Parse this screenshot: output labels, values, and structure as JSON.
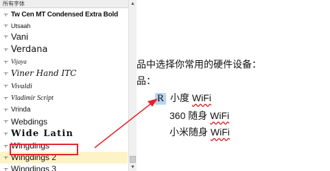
{
  "font_panel": {
    "header": "所有字体",
    "tt_glyph": "ㅜ",
    "items": [
      {
        "label": "Tw Cen MT Condensed Extra Bold"
      },
      {
        "label": "Utsaah"
      },
      {
        "label": "Vani"
      },
      {
        "label": "Verdana"
      },
      {
        "label": "Vijaya"
      },
      {
        "label": "Viner Hand ITC"
      },
      {
        "label": "Vivaldi"
      },
      {
        "label": "Vladimir Script"
      },
      {
        "label": "Vrinda"
      },
      {
        "label": "Webdings"
      },
      {
        "label": "Wide Latin"
      },
      {
        "label": "Wingdings"
      },
      {
        "label": "Wingdings 2",
        "selected": true
      },
      {
        "label": "Wingdings 3"
      }
    ],
    "scroll_up_icon": "▲",
    "scroll_down_icon": "▼"
  },
  "document": {
    "line1": "品中选择你常用的硬件设备：",
    "line2": "品：",
    "symbol": "R",
    "items": [
      {
        "prefix": "小度 ",
        "wifi": "WiFi"
      },
      {
        "prefix": "360 随身 ",
        "wifi": "WiFi"
      },
      {
        "prefix": "小米随身 ",
        "wifi": "WiFi"
      }
    ]
  },
  "colors": {
    "highlight_red": "#e0242c",
    "selection_yellow": "#fdf3c6",
    "symbol_highlight_blue": "#b9d5f2"
  }
}
